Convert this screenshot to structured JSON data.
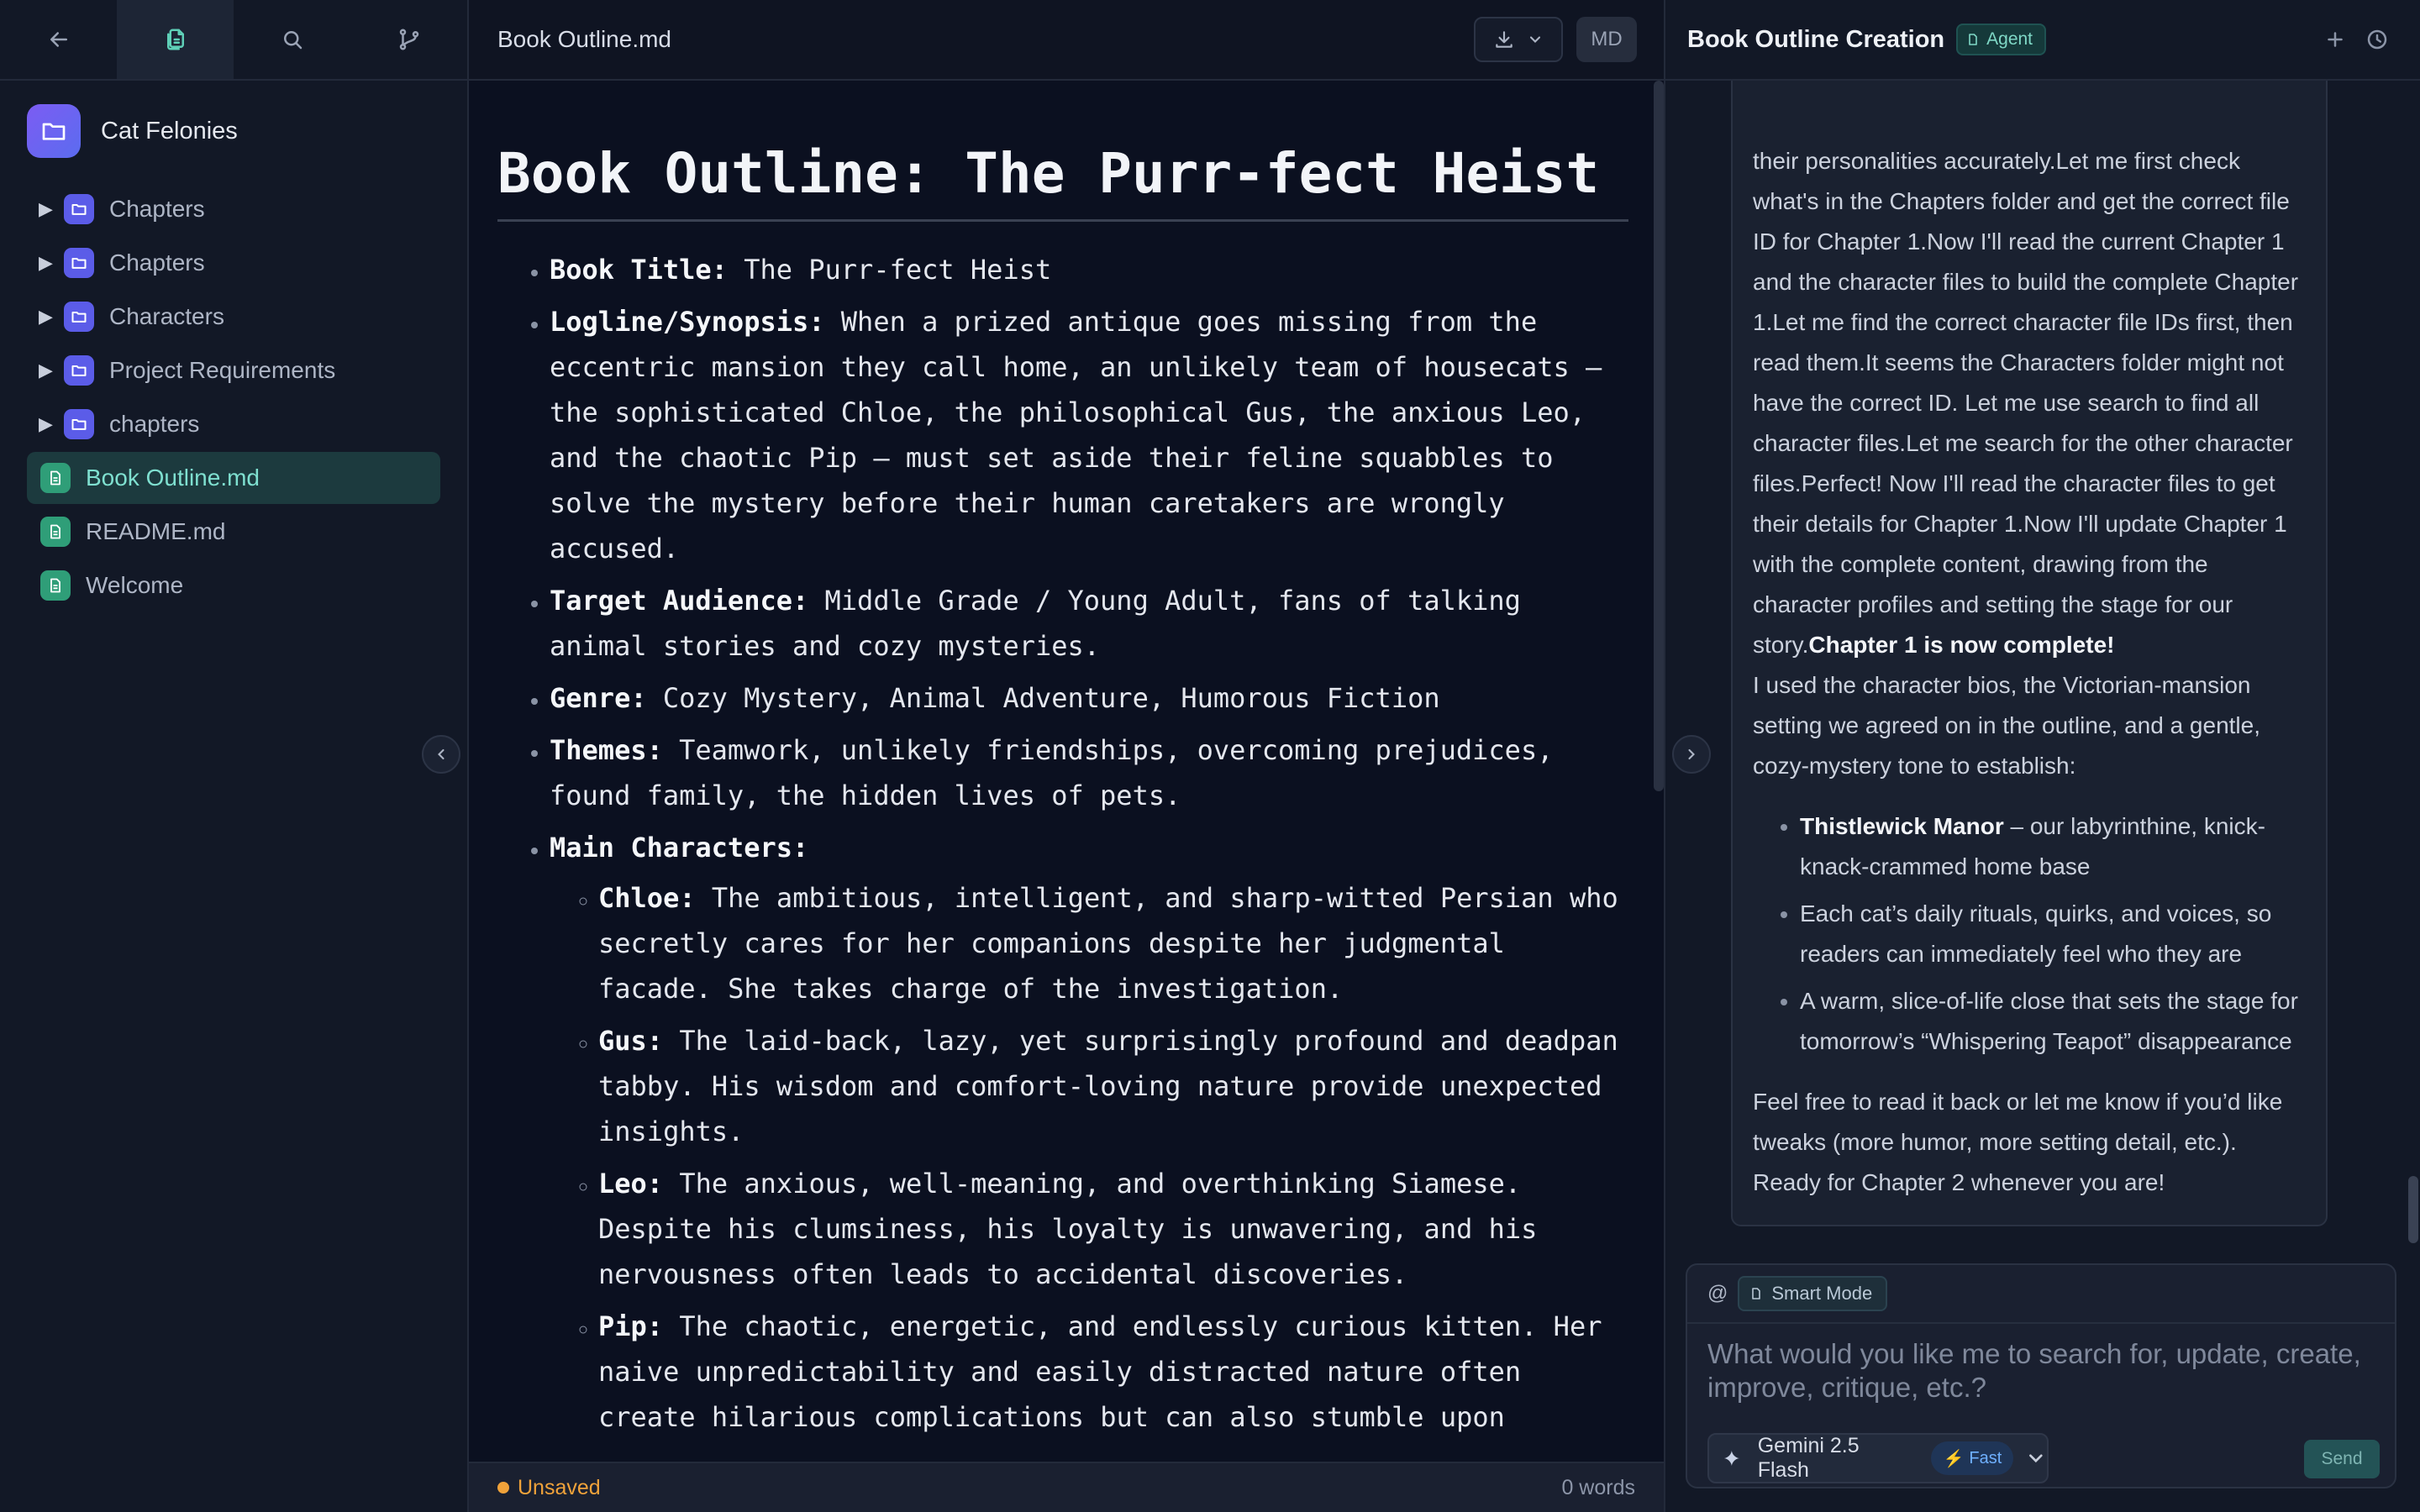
{
  "sidebar": {
    "toolbar": [
      "back",
      "files",
      "search",
      "branches"
    ],
    "workspace_name": "Cat Felonies",
    "items": [
      {
        "label": "Chapters",
        "type": "folder"
      },
      {
        "label": "Chapters",
        "type": "folder"
      },
      {
        "label": "Characters",
        "type": "folder"
      },
      {
        "label": "Project Requirements",
        "type": "folder"
      },
      {
        "label": "chapters",
        "type": "folder"
      },
      {
        "label": "Book Outline.md",
        "type": "file",
        "selected": true
      },
      {
        "label": "README.md",
        "type": "file"
      },
      {
        "label": "Welcome",
        "type": "file"
      }
    ]
  },
  "editor": {
    "file_title": "Book Outline.md",
    "format_label": "MD",
    "heading": "Book Outline: The Purr-fect Heist",
    "sections": {
      "title": {
        "key": "Book Title:",
        "text": " The Purr-fect Heist"
      },
      "logline": {
        "key": "Logline/Synopsis:",
        "text": " When a prized antique goes missing from the eccentric mansion they call home, an unlikely team of housecats – the sophisticated Chloe, the philosophical Gus, the anxious Leo, and the chaotic Pip – must set aside their feline squabbles to solve the mystery before their human caretakers are wrongly accused."
      },
      "audience": {
        "key": "Target Audience:",
        "text": " Middle Grade / Young Adult, fans of talking animal stories and cozy mysteries."
      },
      "genre": {
        "key": "Genre:",
        "text": " Cozy Mystery, Animal Adventure, Humorous Fiction"
      },
      "themes": {
        "key": "Themes:",
        "text": " Teamwork, unlikely friendships, overcoming prejudices, found family, the hidden lives of pets."
      },
      "characters": {
        "key": "Main Characters:"
      }
    },
    "characters": [
      {
        "key": "Chloe:",
        "text": " The ambitious, intelligent, and sharp-witted Persian who secretly cares for her companions despite her judgmental facade. She takes charge of the investigation."
      },
      {
        "key": "Gus:",
        "text": " The laid-back, lazy, yet surprisingly profound and deadpan tabby. His wisdom and comfort-loving nature provide unexpected insights."
      },
      {
        "key": "Leo:",
        "text": " The anxious, well-meaning, and overthinking Siamese. Despite his clumsiness, his loyalty is unwavering, and his nervousness often leads to accidental discoveries."
      },
      {
        "key": "Pip:",
        "text": " The chaotic, energetic, and endlessly curious kitten. Her naive unpredictability and easily distracted nature often create hilarious complications but can also stumble upon"
      }
    ],
    "status": {
      "unsaved": "Unsaved",
      "word_count": "0 words"
    }
  },
  "chat": {
    "title": "Book Outline Creation",
    "mode_badge": "Agent",
    "message": {
      "intro": "their personalities accurately.Let me first check what's in the Chapters folder and get the correct file ID for Chapter 1.Now I'll read the current Chapter 1 and the character files to build the complete Chapter 1.Let me find the correct character file IDs first, then read them.It seems the Characters folder might not have the correct ID. Let me use search to find all character files.Let me search for the other character files.Perfect! Now I'll read the character files to get their details for Chapter 1.Now I'll update Chapter 1 with the complete content, drawing from the character profiles and setting the stage for our story.",
      "complete": "Chapter 1 is now complete!",
      "line2": "I used the character bios, the Victorian-mansion setting we agreed on in the outline, and a gentle, cozy-mystery tone to establish:",
      "bullets": [
        {
          "bold": "Thistlewick Manor",
          "text": " – our labyrinthine, knick-knack-crammed home base"
        },
        {
          "bold": "",
          "text": "Each cat’s daily rituals, quirks, and voices, so readers can immediately feel who they are"
        },
        {
          "bold": "",
          "text": "A warm, slice-of-life close that sets the stage for tomorrow’s “Whispering Teapot” disappearance"
        }
      ],
      "closing": "Feel free to read it back or let me know if you’d like tweaks (more humor, more setting detail, etc.). Ready for Chapter 2 whenever you are!"
    },
    "composer": {
      "mention": "@",
      "smart_mode": "Smart Mode",
      "placeholder": "What would you like me to search for, update, create, improve, critique, etc.?",
      "model": "Gemini 2.5 Flash",
      "speed": "Fast",
      "send": "Send"
    }
  },
  "colors": {
    "accent_teal": "#2f9e78",
    "folder_purple": "#5b5ce8",
    "unsaved_orange": "#f0a23a"
  }
}
